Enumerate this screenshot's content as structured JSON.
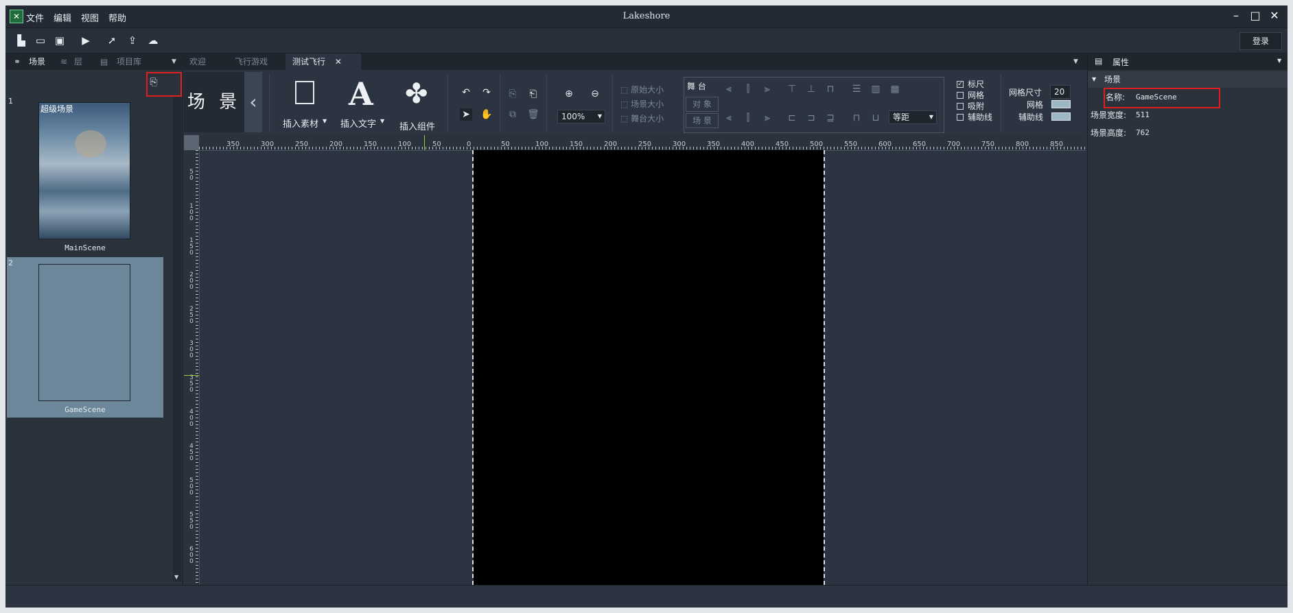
{
  "app": {
    "title": "Lakeshore",
    "menu": [
      "文件",
      "编辑",
      "视图",
      "帮助"
    ],
    "login_label": "登录"
  },
  "left_tabs": [
    "场景",
    "层",
    "项目库"
  ],
  "doc_tabs": [
    "欢迎",
    "飞行游戏",
    "测试飞行"
  ],
  "scenes": [
    {
      "num": "1",
      "title": "超级场景",
      "name": "MainScene"
    },
    {
      "num": "2",
      "title": "",
      "name": "GameScene"
    }
  ],
  "ribbon": {
    "scene_label": "场 景",
    "insert_asset": "插入素材",
    "insert_text": "插入文字",
    "insert_component": "插入组件",
    "zoom": "100%",
    "size_options": [
      "原始大小",
      "场景大小",
      "舞台大小"
    ],
    "align_modes": [
      "舞 台",
      "对 象",
      "场 景"
    ],
    "spacing": "等距",
    "checks": [
      {
        "label": "标尺",
        "checked": true
      },
      {
        "label": "网格",
        "checked": false
      },
      {
        "label": "吸附",
        "checked": false
      },
      {
        "label": "辅助线",
        "checked": false
      }
    ],
    "grid_size_label": "网格尺寸",
    "grid_size_value": "20",
    "grid_color_label": "网格",
    "guide_color_label": "辅助线"
  },
  "ruler_h": [
    "350",
    "300",
    "250",
    "200",
    "150",
    "100",
    "50",
    "0",
    "50",
    "100",
    "150",
    "200",
    "250",
    "300",
    "350",
    "400",
    "450",
    "500",
    "550",
    "600",
    "650",
    "700",
    "750",
    "800",
    "850"
  ],
  "ruler_v": [
    "50",
    "100",
    "150",
    "200",
    "250",
    "300",
    "350",
    "400",
    "450",
    "500",
    "550",
    "600"
  ],
  "properties": {
    "tab": "属性",
    "group": "场景",
    "name_label": "名称:",
    "name_value": "GameScene",
    "width_label": "场景宽度:",
    "width_value": "511",
    "height_label": "场景高度:",
    "height_value": "762"
  }
}
